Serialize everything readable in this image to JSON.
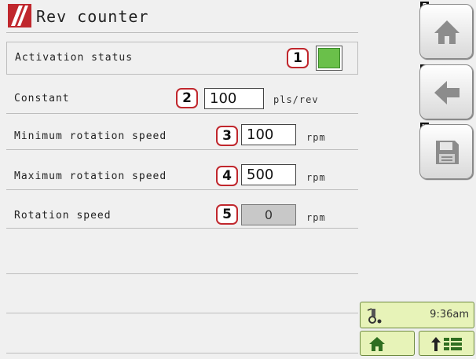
{
  "app": {
    "title": "Rev counter",
    "accent_color": "#c0272d"
  },
  "rows": [
    {
      "badge": "1",
      "label": "Activation status",
      "control": "toggle",
      "toggle_on": true,
      "toggle_color": "#6ac04a"
    },
    {
      "badge": "2",
      "label": "Constant",
      "value": "100",
      "unit": "pls/rev"
    },
    {
      "badge": "3",
      "label": "Minimum rotation speed",
      "value": "100",
      "unit": "rpm"
    },
    {
      "badge": "4",
      "label": "Maximum rotation speed",
      "value": "500",
      "unit": "rpm"
    },
    {
      "badge": "5",
      "label": "Rotation speed",
      "value": "0",
      "unit": "rpm",
      "readonly": true
    }
  ],
  "side_buttons": [
    {
      "key": "F",
      "icon": "home-icon"
    },
    {
      "key": "G",
      "icon": "back-arrow-icon"
    },
    {
      "key": "H",
      "icon": "save-icon"
    }
  ],
  "status": {
    "icon": "gps-tractor-icon",
    "time": "9:36am"
  },
  "bottom_buttons": [
    {
      "icon": "home-icon"
    },
    {
      "icon": "menu-up-icon"
    }
  ]
}
